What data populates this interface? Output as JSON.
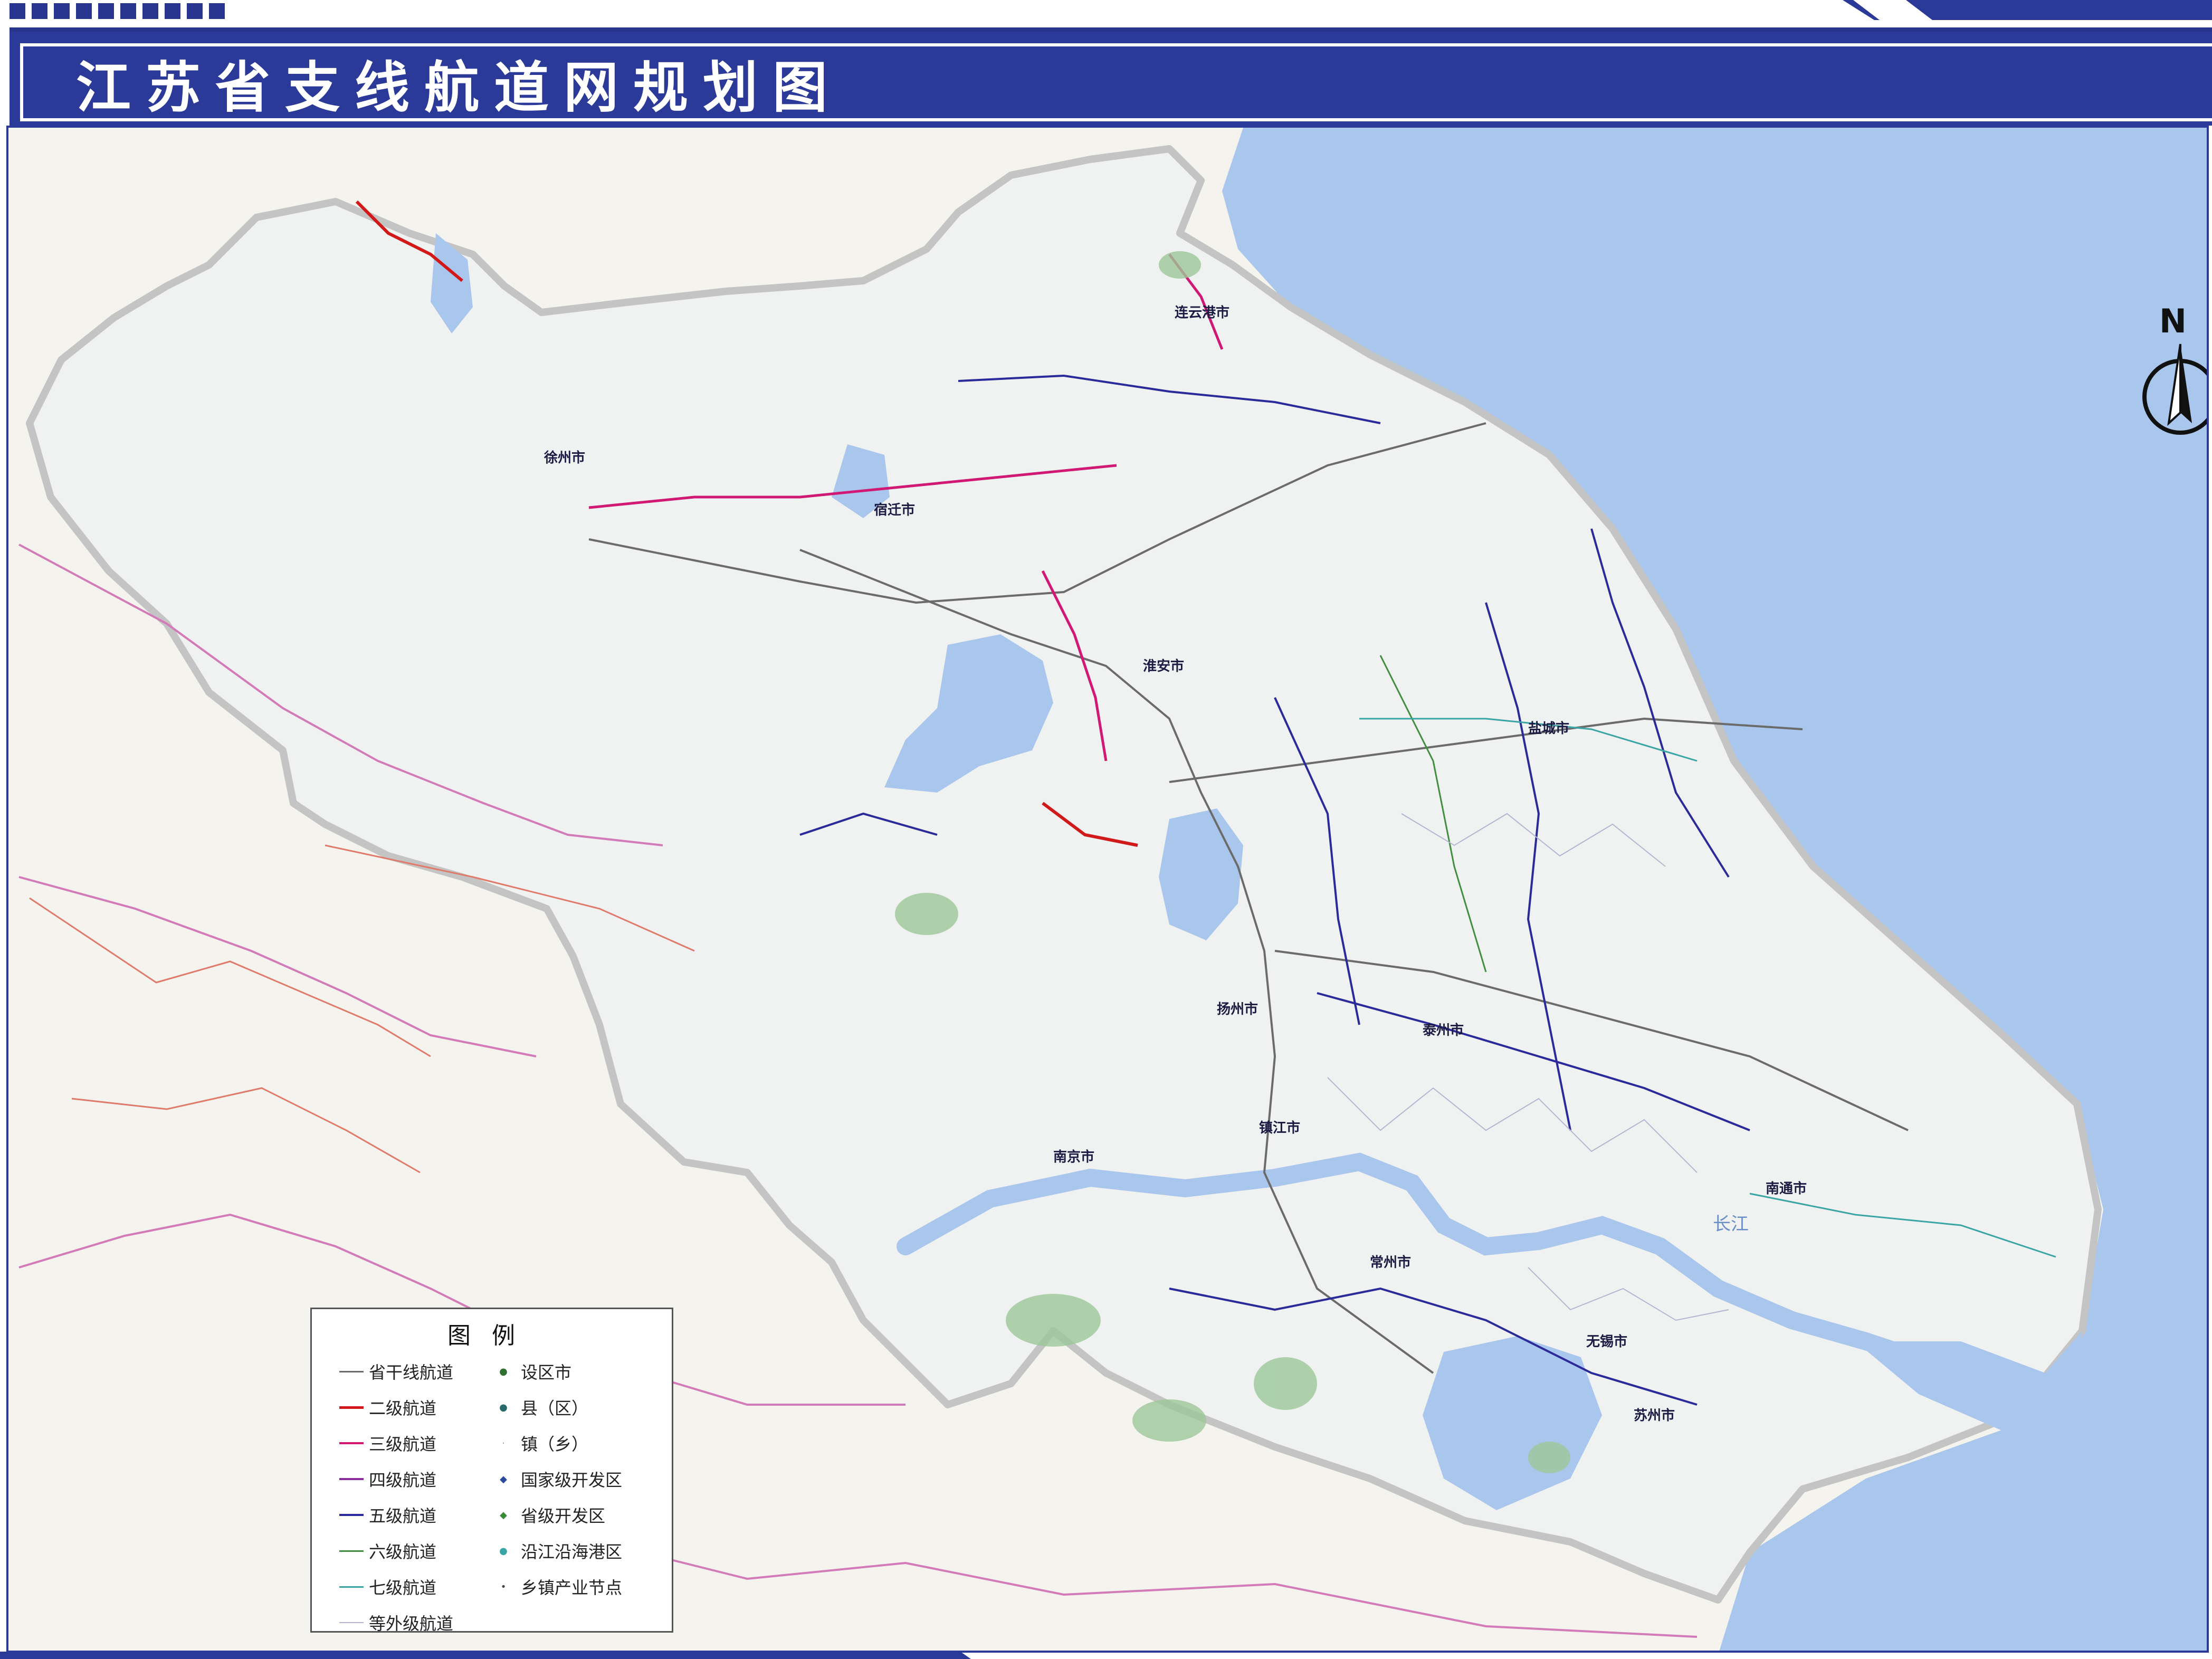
{
  "page": {
    "title": "江苏省支线航道网规划图"
  },
  "colors": {
    "brand_blue": "#2b3a98",
    "sea": "#a9c6ec",
    "province_fill": "#f0f1f1",
    "outside_land": "#f5f3ee",
    "province_border": "#c4c4c4"
  },
  "compass": {
    "north_label": "N",
    "icon": "north-arrow-icon"
  },
  "legend": {
    "title": "图例",
    "lines": [
      {
        "label": "省干线航道",
        "color": "#6b6b6b",
        "width": 3
      },
      {
        "label": "二级航道",
        "color": "#d11919",
        "width": 5
      },
      {
        "label": "三级航道",
        "color": "#d01874",
        "width": 4
      },
      {
        "label": "四级航道",
        "color": "#8a2c9c",
        "width": 4
      },
      {
        "label": "五级航道",
        "color": "#2a2a9a",
        "width": 4
      },
      {
        "label": "六级航道",
        "color": "#3f8f3f",
        "width": 3
      },
      {
        "label": "七级航道",
        "color": "#3aa5a5",
        "width": 3
      },
      {
        "label": "等外级航道",
        "color": "#b5b5d0",
        "width": 2
      }
    ],
    "points": [
      {
        "label": "设区市",
        "color": "#2f6f2f",
        "icon": "city-dot-icon"
      },
      {
        "label": "县（区）",
        "color": "#2a6a6a",
        "icon": "county-dot-icon"
      },
      {
        "label": "镇（乡）",
        "color": "#8aa0b5",
        "icon": "town-dot-icon"
      },
      {
        "label": "国家级开发区",
        "color": "#2a4a9a",
        "icon": "national-zone-icon"
      },
      {
        "label": "省级开发区",
        "color": "#3a8a3a",
        "icon": "provincial-zone-icon"
      },
      {
        "label": "沿江沿海港区",
        "color": "#3aa5a5",
        "icon": "port-area-icon"
      },
      {
        "label": "乡镇产业节点",
        "color": "#444444",
        "icon": "industry-node-icon"
      }
    ]
  },
  "cities": [
    {
      "name": "徐州市"
    },
    {
      "name": "连云港市"
    },
    {
      "name": "宿迁市"
    },
    {
      "name": "淮安市"
    },
    {
      "name": "盐城市"
    },
    {
      "name": "扬州市"
    },
    {
      "name": "泰州市"
    },
    {
      "name": "南京市"
    },
    {
      "name": "镇江市"
    },
    {
      "name": "常州市"
    },
    {
      "name": "无锡市"
    },
    {
      "name": "苏州市"
    },
    {
      "name": "南通市"
    }
  ],
  "water_labels": {
    "yangtze": "长江"
  }
}
